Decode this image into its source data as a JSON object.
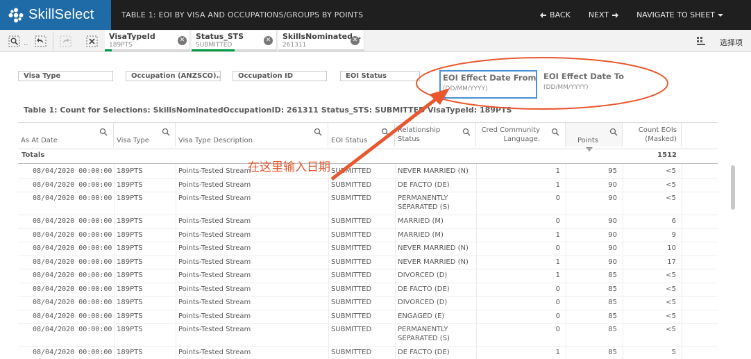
{
  "app": {
    "logo_text": "SkillSelect",
    "sheet_title": "TABLE 1: EOI BY VISA AND OCCUPATIONS/GROUPS BY POINTS",
    "back_label": "BACK",
    "next_label": "NEXT",
    "navigate_label": "NAVIGATE TO SHEET",
    "colors": {
      "topbar": "#1f1f1f",
      "logo_bg": "#1f6ba8",
      "selected_green": "#009845",
      "annotation": "#e8572e"
    }
  },
  "selections_bar": {
    "chips": [
      {
        "field": "VisaTypeId",
        "value": "189PTS"
      },
      {
        "field": "Status_STS",
        "value": "SUBMITTED"
      },
      {
        "field": "SkillsNominated...",
        "value": "261311"
      }
    ],
    "menu_label": "选择项"
  },
  "filters": {
    "boxes": [
      "Visa Type",
      "Occupation (ANZSCO)...",
      "Occupation ID",
      "EOI Status"
    ],
    "date_from": {
      "label": "EOI Effect Date From",
      "placeholder": "(DD/MM/YYYY)"
    },
    "date_to": {
      "label": "EOI Effect Date To",
      "placeholder": "(DD/MM/YYYY)"
    }
  },
  "table": {
    "caption": "Table 1: Count for Selections: SkillsNominatedOccupationID: 261311 Status_STS: SUBMITTED VisaTypeId: 189PTS",
    "headers": [
      "As At Date",
      "Visa Type",
      "Visa Type Description",
      "EOI Status",
      "Relationship Status",
      "Cred Community Language.",
      "Points",
      "Count EOIs (Masked)"
    ],
    "totals_label": "Totals",
    "totals_value": "1512",
    "rows": [
      [
        "08/04/2020 00:00:00",
        "189PTS",
        "Points-Tested Stream",
        "SUBMITTED",
        "NEVER MARRIED (N)",
        "1",
        "95",
        "<5"
      ],
      [
        "08/04/2020 00:00:00",
        "189PTS",
        "Points-Tested Stream",
        "SUBMITTED",
        "DE FACTO (DE)",
        "1",
        "90",
        "<5"
      ],
      [
        "08/04/2020 00:00:00",
        "189PTS",
        "Points-Tested Stream",
        "SUBMITTED",
        "PERMANENTLY SEPARATED (S)",
        "0",
        "90",
        "<5"
      ],
      [
        "08/04/2020 00:00:00",
        "189PTS",
        "Points-Tested Stream",
        "SUBMITTED",
        "MARRIED (M)",
        "0",
        "90",
        "6"
      ],
      [
        "08/04/2020 00:00:00",
        "189PTS",
        "Points-Tested Stream",
        "SUBMITTED",
        "MARRIED (M)",
        "1",
        "90",
        "9"
      ],
      [
        "08/04/2020 00:00:00",
        "189PTS",
        "Points-Tested Stream",
        "SUBMITTED",
        "NEVER MARRIED (N)",
        "0",
        "90",
        "10"
      ],
      [
        "08/04/2020 00:00:00",
        "189PTS",
        "Points-Tested Stream",
        "SUBMITTED",
        "NEVER MARRIED (N)",
        "1",
        "90",
        "17"
      ],
      [
        "08/04/2020 00:00:00",
        "189PTS",
        "Points-Tested Stream",
        "SUBMITTED",
        "DIVORCED (D)",
        "1",
        "85",
        "<5"
      ],
      [
        "08/04/2020 00:00:00",
        "189PTS",
        "Points-Tested Stream",
        "SUBMITTED",
        "DE FACTO (DE)",
        "0",
        "85",
        "<5"
      ],
      [
        "08/04/2020 00:00:00",
        "189PTS",
        "Points-Tested Stream",
        "SUBMITTED",
        "DIVORCED (D)",
        "0",
        "85",
        "<5"
      ],
      [
        "08/04/2020 00:00:00",
        "189PTS",
        "Points-Tested Stream",
        "SUBMITTED",
        "ENGAGED (E)",
        "0",
        "85",
        "<5"
      ],
      [
        "08/04/2020 00:00:00",
        "189PTS",
        "Points-Tested Stream",
        "SUBMITTED",
        "PERMANENTLY SEPARATED (S)",
        "0",
        "85",
        "<5"
      ],
      [
        "08/04/2020 00:00:00",
        "189PTS",
        "Points-Tested Stream",
        "SUBMITTED",
        "DE FACTO (DE)",
        "1",
        "85",
        "5"
      ]
    ]
  },
  "annotation": {
    "text": "在这里输入日期"
  }
}
